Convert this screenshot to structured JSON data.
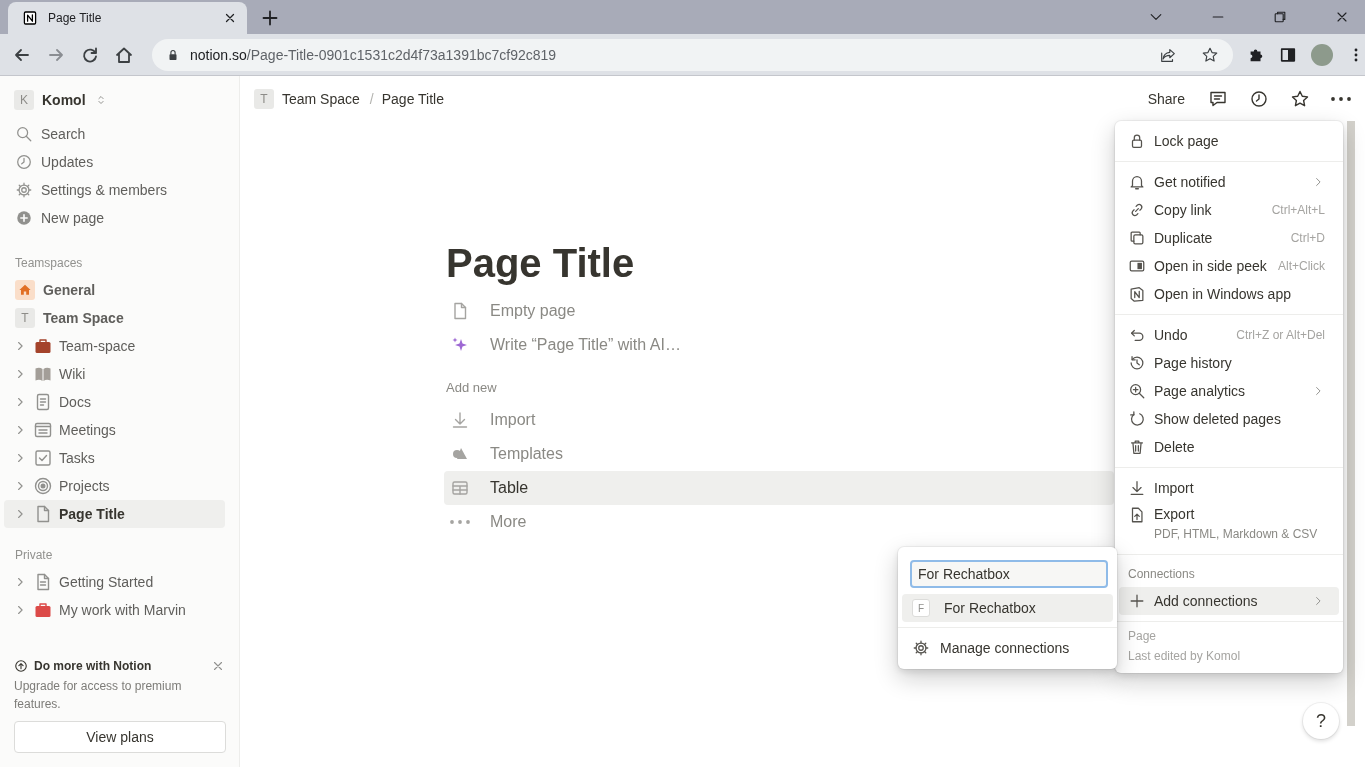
{
  "browser": {
    "tab": {
      "title": "Page Title"
    },
    "url": {
      "host": "notion.so",
      "path": "/Page-Title-0901c1531c2d4f73a1391bc7cf92c819"
    }
  },
  "sidebar": {
    "workspace": {
      "badge": "K",
      "name": "Komol"
    },
    "nav": [
      {
        "label": "Search"
      },
      {
        "label": "Updates"
      },
      {
        "label": "Settings & members"
      },
      {
        "label": "New page"
      }
    ],
    "teamspaces": {
      "heading": "Teamspaces",
      "items": [
        {
          "kind": "space",
          "label": "General",
          "selected": false
        },
        {
          "kind": "space",
          "badge": "T",
          "label": "Team Space",
          "selected": false
        },
        {
          "kind": "page",
          "label": "Team-space",
          "expanded": false,
          "selected": false
        },
        {
          "kind": "page",
          "label": "Wiki",
          "expanded": false,
          "selected": false
        },
        {
          "kind": "page",
          "label": "Docs",
          "expanded": false,
          "selected": false
        },
        {
          "kind": "page",
          "label": "Meetings",
          "expanded": false,
          "selected": false
        },
        {
          "kind": "page",
          "label": "Tasks",
          "expanded": false,
          "selected": false
        },
        {
          "kind": "page",
          "label": "Projects",
          "expanded": false,
          "selected": false
        },
        {
          "kind": "page",
          "label": "Page Title",
          "expanded": false,
          "selected": true
        }
      ]
    },
    "private": {
      "heading": "Private",
      "items": [
        {
          "kind": "page",
          "label": "Getting Started",
          "expanded": false,
          "selected": false
        },
        {
          "kind": "page",
          "label": "My work with Marvin",
          "expanded": false,
          "selected": false
        }
      ]
    },
    "promo": {
      "title": "Do more with Notion",
      "text": "Upgrade for access to premium features.",
      "button": "View plans"
    }
  },
  "topbar": {
    "breadcrumb": [
      {
        "badge": "T",
        "label": "Team Space"
      },
      {
        "label": "Page Title"
      }
    ],
    "separator": "/",
    "share": "Share"
  },
  "page": {
    "title": "Page Title",
    "options": [
      {
        "label": "Empty page"
      },
      {
        "label": "Write “Page Title” with AI…"
      }
    ],
    "add_new": {
      "heading": "Add new",
      "items": [
        {
          "label": "Import",
          "highlighted": false
        },
        {
          "label": "Templates",
          "highlighted": false
        },
        {
          "label": "Table",
          "highlighted": true
        },
        {
          "label": "More",
          "highlighted": false
        }
      ]
    }
  },
  "menu": {
    "sections": [
      {
        "items": [
          {
            "label": "Lock page",
            "submenu": false
          }
        ]
      },
      {
        "items": [
          {
            "label": "Get notified",
            "submenu": true
          },
          {
            "label": "Copy link",
            "shortcut": "Ctrl+Alt+L",
            "submenu": false
          },
          {
            "label": "Duplicate",
            "shortcut": "Ctrl+D",
            "submenu": false
          },
          {
            "label": "Open in side peek",
            "shortcut": "Alt+Click",
            "submenu": false
          },
          {
            "label": "Open in Windows app",
            "submenu": false
          }
        ]
      },
      {
        "items": [
          {
            "label": "Undo",
            "shortcut": "Ctrl+Z or Alt+Del",
            "submenu": false
          },
          {
            "label": "Page history",
            "submenu": false
          },
          {
            "label": "Page analytics",
            "submenu": true
          },
          {
            "label": "Show deleted pages",
            "submenu": false
          },
          {
            "label": "Delete",
            "submenu": false
          }
        ]
      },
      {
        "items": [
          {
            "label": "Import",
            "submenu": false
          },
          {
            "label": "Export",
            "sublabel": "PDF, HTML, Markdown & CSV",
            "submenu": false
          }
        ]
      }
    ],
    "connections": {
      "heading": "Connections",
      "item": {
        "label": "Add connections",
        "submenu": true,
        "highlighted": true
      }
    },
    "footer": {
      "heading": "Page",
      "text": "Last edited by Komol"
    }
  },
  "connections_popup": {
    "search": {
      "value": "For Rechatbox"
    },
    "results": [
      {
        "badge": "F",
        "label": "For Rechatbox",
        "highlighted": true
      }
    ],
    "manage": "Manage connections"
  },
  "help": "?"
}
